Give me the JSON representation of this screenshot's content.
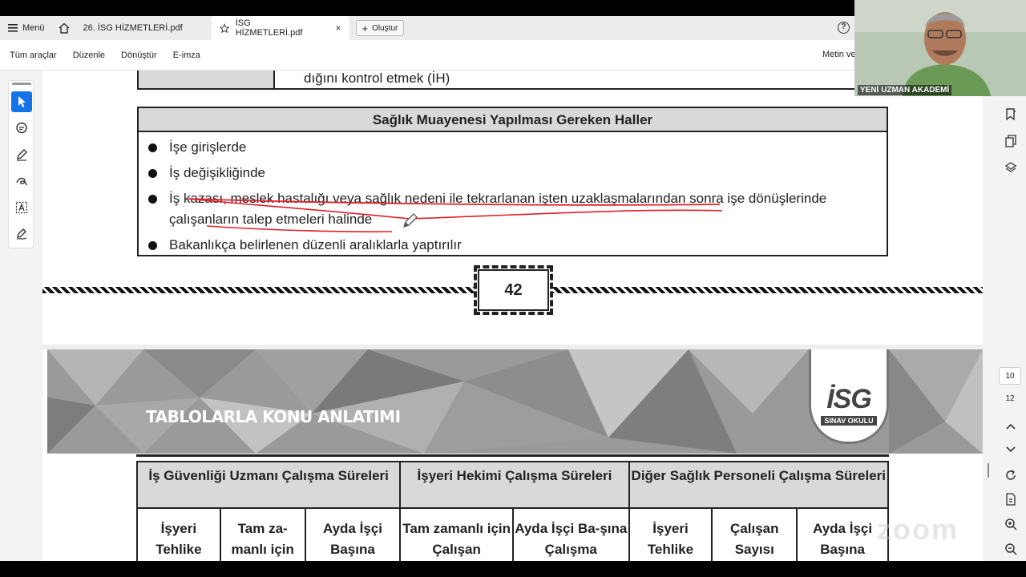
{
  "browser": {
    "menu_label": "Menü",
    "tabs": [
      {
        "label": "26. İSG HİZMETLERİ.pdf"
      },
      {
        "label": "İSG HİZMETLERİ.pdf"
      }
    ],
    "close_glyph": "×",
    "create_label": "Oluştur",
    "help_glyph": "?"
  },
  "toolbar": {
    "items": [
      "Tüm araçlar",
      "Düzenle",
      "Dönüştür",
      "E-imza"
    ],
    "right_label": "Metin ve"
  },
  "document": {
    "prev_row_text": "dığını kontrol etmek (İH)",
    "health_section": {
      "title": "Sağlık Muayenesi Yapılması Gereken Haller",
      "items": [
        "İşe girişlerde",
        "İş değişikliğinde",
        "İş kazası, meslek hastalığı veya sağlık nedeni ile tekrarlanan işten uzaklaşmalarından sonra işe dönüşlerinde çalışanların talep etmeleri halinde",
        "Bakanlıkça belirlenen düzenli aralıklarla yaptırılır"
      ]
    },
    "page_number": "42",
    "banner_title": "TABLOLARLA KONU ANLATIMI",
    "logo": {
      "main": "İSG",
      "sub": "SINAV OKULU"
    },
    "work_table": {
      "headers": [
        "İş Güvenliği Uzmanı Çalışma Süreleri",
        "İşyeri Hekimi Çalışma Süreleri",
        "Diğer Sağlık Personeli Çalışma Süreleri"
      ],
      "subheaders": [
        "İşyeri Tehlike",
        "Tam za-manlı için Çalışan",
        "Ayda İşçi Başına Çalışma",
        "Tam zamanlı için Çalışan",
        "Ayda İşçi Ba-şına Çalışma",
        "İşyeri Tehlike",
        "Çalışan Sayısı",
        "Ayda İşçi Başına Çalışma"
      ]
    }
  },
  "sidebar_right": {
    "page_current": "10",
    "page_total": "12"
  },
  "webcam": {
    "label": "YENİ UZMAN AKADEMİ"
  },
  "watermark": "zoom",
  "colors": {
    "accent": "#1473e6",
    "annotation": "#e0202a",
    "header_gray": "#d9d9d9"
  }
}
